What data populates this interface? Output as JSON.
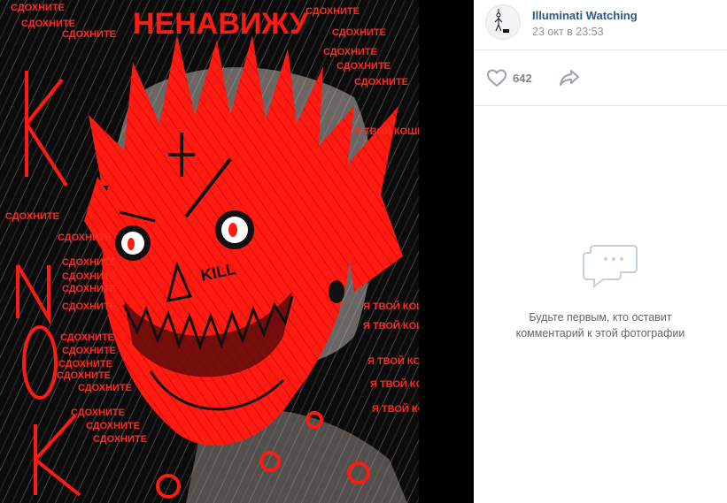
{
  "post": {
    "author": "Illuminati Watching",
    "date": "23 окт в 23:53"
  },
  "actions": {
    "likes": "642"
  },
  "comments": {
    "empty_line1": "Будьте первым, кто оставит",
    "empty_line2": "комментарий к этой фотографии"
  },
  "photo": {
    "title_text": "НЕНАВИЖУ",
    "kill_text": "KILL",
    "repeat_text": "СДОХНИТЕ",
    "side_text": "Я ТВОЙ КОШМАР",
    "colors": {
      "red": "#ff1a12",
      "black": "#0b0b0b"
    }
  },
  "icons": {
    "like": "heart-icon",
    "share": "share-arrow-icon",
    "comments": "comment-bubbles-icon",
    "avatar": "hanging-figure-avatar"
  }
}
